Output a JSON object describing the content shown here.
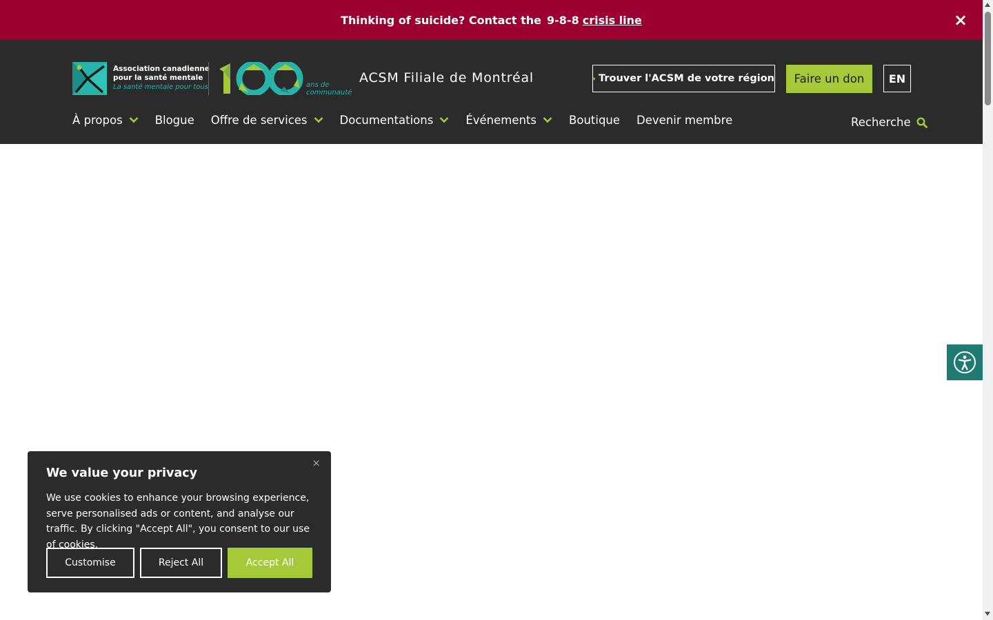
{
  "crisis_banner": {
    "text": "Thinking of suicide? Contact the",
    "number": "9-8-8",
    "link": "crisis line",
    "close": "×",
    "bg_color": "#9b0030"
  },
  "header": {
    "org_name_line1": "Association canadienne",
    "org_name_line2": "pour la santé mentale",
    "org_tagline": "La santé mentale pour tous",
    "anniversary_line1": "ans de",
    "anniversary_line2": "communauté",
    "branch_name": "ACSM Filiale de Montréal",
    "find_region": "Trouver l'ACSM de votre région",
    "donate": "Faire un don",
    "lang": "EN",
    "search_label": "Recherche",
    "accent_color": "#a6c93a",
    "teal_color": "#27b3a8"
  },
  "nav": {
    "items": [
      {
        "label": "À propos",
        "dropdown": true
      },
      {
        "label": "Blogue",
        "dropdown": false
      },
      {
        "label": "Offre de services",
        "dropdown": true
      },
      {
        "label": "Documentations",
        "dropdown": true
      },
      {
        "label": "Événements",
        "dropdown": true
      },
      {
        "label": "Boutique",
        "dropdown": false
      },
      {
        "label": "Devenir membre",
        "dropdown": false
      }
    ]
  },
  "cookie": {
    "title": "We value your privacy",
    "body": "We use cookies to enhance your browsing experience, serve personalised ads or content, and analyse our traffic. By clicking \"Accept All\", you consent to our use of cookies.",
    "customise": "Customise",
    "reject": "Reject All",
    "accept": "Accept All",
    "close": "×"
  }
}
